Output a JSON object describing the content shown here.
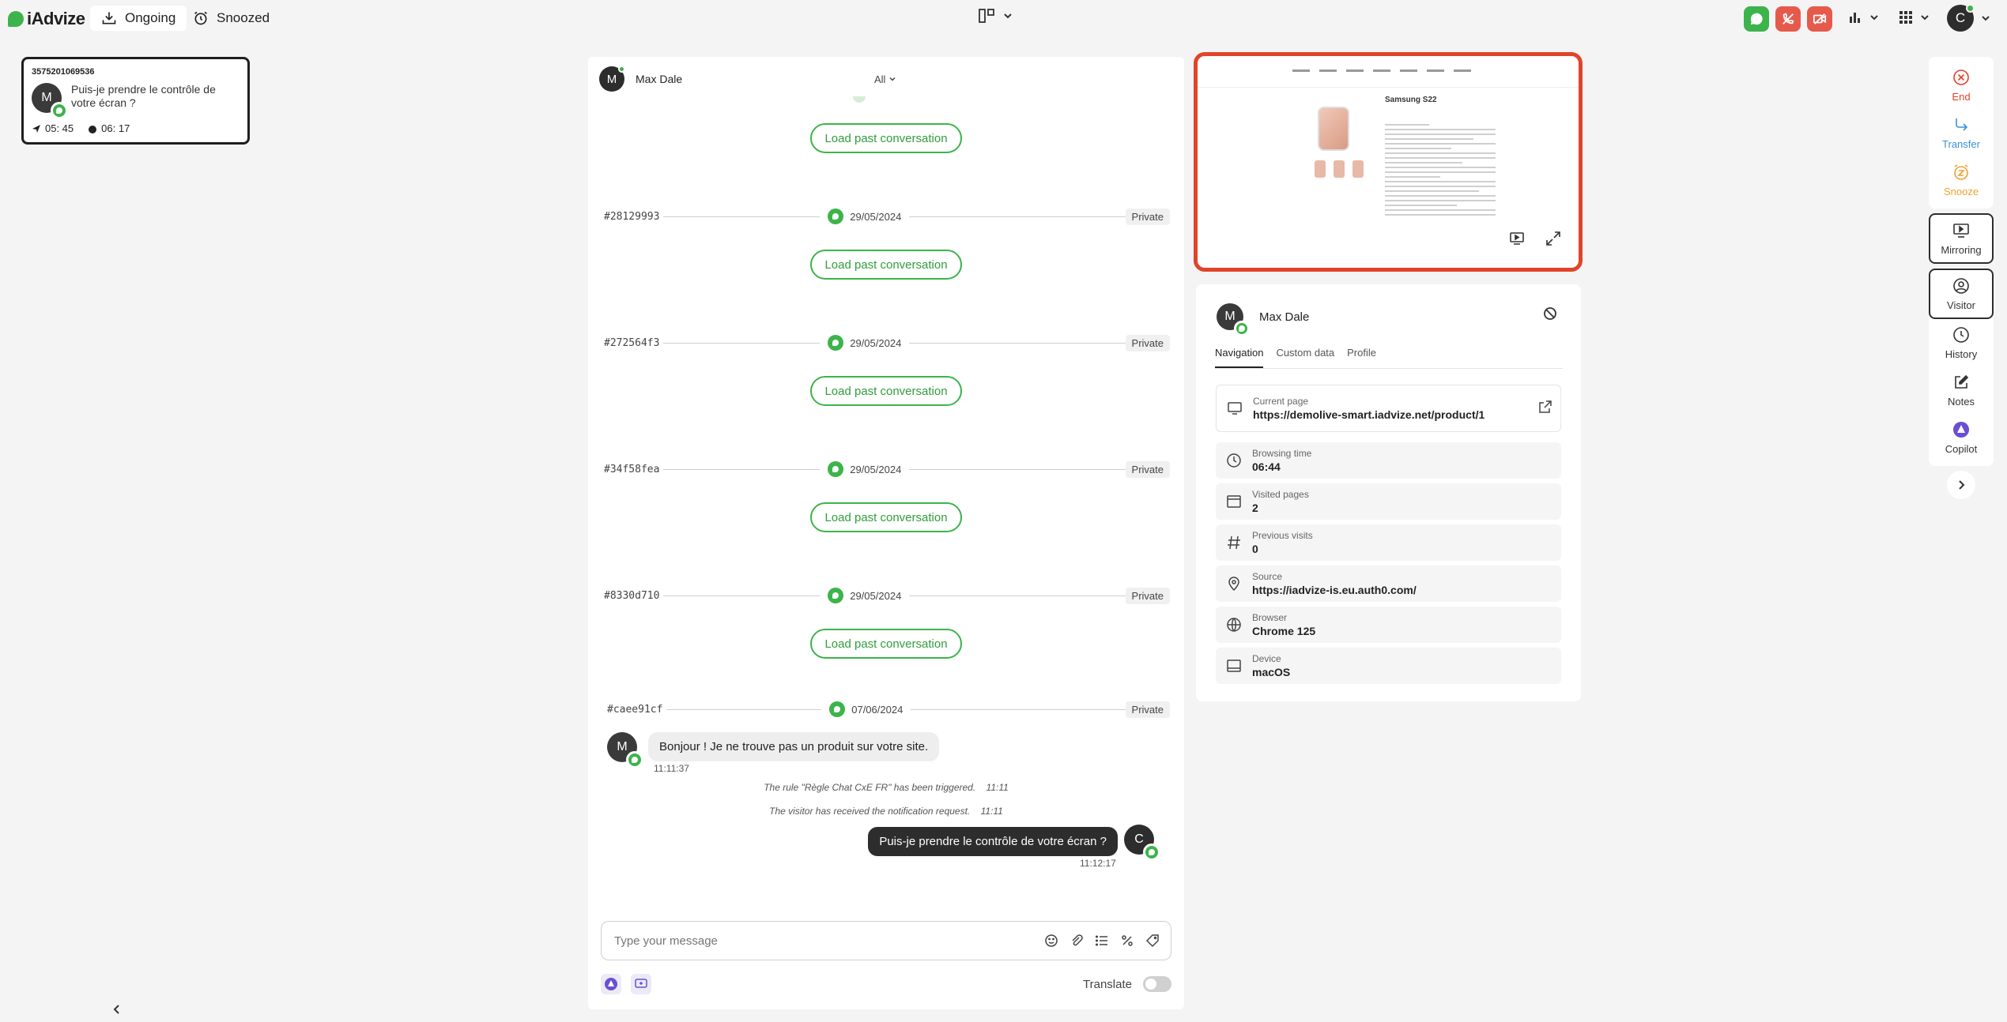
{
  "app": {
    "name": "iAdvize"
  },
  "nav": {
    "ongoing": "Ongoing",
    "snoozed": "Snoozed"
  },
  "user_initial": "C",
  "conversation_card": {
    "id": "3575201069536",
    "initial": "M",
    "preview": "Puis-je prendre le contrôle de votre écran ?",
    "time_a": "05: 45",
    "time_b": "06: 17"
  },
  "chat": {
    "visitor_name": "Max Dale",
    "visitor_initial": "M",
    "filter": "All",
    "load_label": "Load past conversation",
    "past": [
      {
        "id": "#28129993",
        "date": "29/05/2024",
        "tag": "Private"
      },
      {
        "id": "#272564f3",
        "date": "29/05/2024",
        "tag": "Private"
      },
      {
        "id": "#34f58fea",
        "date": "29/05/2024",
        "tag": "Private"
      },
      {
        "id": "#8330d710",
        "date": "29/05/2024",
        "tag": "Private"
      },
      {
        "id": "#caee91cf",
        "date": "07/06/2024",
        "tag": "Private"
      }
    ],
    "visitor_message": "Bonjour ! Je ne trouve pas un produit sur votre site.",
    "visitor_message_time": "11:11:37",
    "system_1": "The rule \"Règle Chat CxE FR\" has been triggered.",
    "system_1_time": "11:11",
    "system_2": "The visitor has received the notification request.",
    "system_2_time": "11:11",
    "agent_message": "Puis-je prendre le contrôle de votre écran ?",
    "agent_message_time": "11:12:17",
    "agent_initial": "C",
    "input_placeholder": "Type your message",
    "translate_label": "Translate"
  },
  "preview": {
    "product_title": "Samsung S22"
  },
  "visitor_panel": {
    "name": "Max Dale",
    "initial": "M",
    "tabs": [
      "Navigation",
      "Custom data",
      "Profile"
    ],
    "current_page_label": "Current page",
    "current_page": "https://demolive-smart.iadvize.net/product/1",
    "fields": [
      {
        "label": "Browsing time",
        "value": "06:44",
        "icon": "clock-icon"
      },
      {
        "label": "Visited pages",
        "value": "2",
        "icon": "browser-window-icon"
      },
      {
        "label": "Previous visits",
        "value": "0",
        "icon": "hash-icon"
      },
      {
        "label": "Source",
        "value": "https://iadvize-is.eu.auth0.com/",
        "icon": "location-pin-icon"
      },
      {
        "label": "Browser",
        "value": "Chrome 125",
        "icon": "globe-icon"
      },
      {
        "label": "Device",
        "value": "macOS",
        "icon": "laptop-icon"
      }
    ]
  },
  "rail": {
    "end": "End",
    "transfer": "Transfer",
    "snooze": "Snooze",
    "mirroring": "Mirroring",
    "visitor": "Visitor",
    "history": "History",
    "notes": "Notes",
    "copilot": "Copilot"
  },
  "colors": {
    "brand_green": "#3cb44b",
    "mirroring_border": "#e0442a",
    "end_red": "#e0442a",
    "transfer_blue": "#3b8fd9",
    "snooze_orange": "#f0a030",
    "copilot_purple": "#6a4fd3"
  }
}
